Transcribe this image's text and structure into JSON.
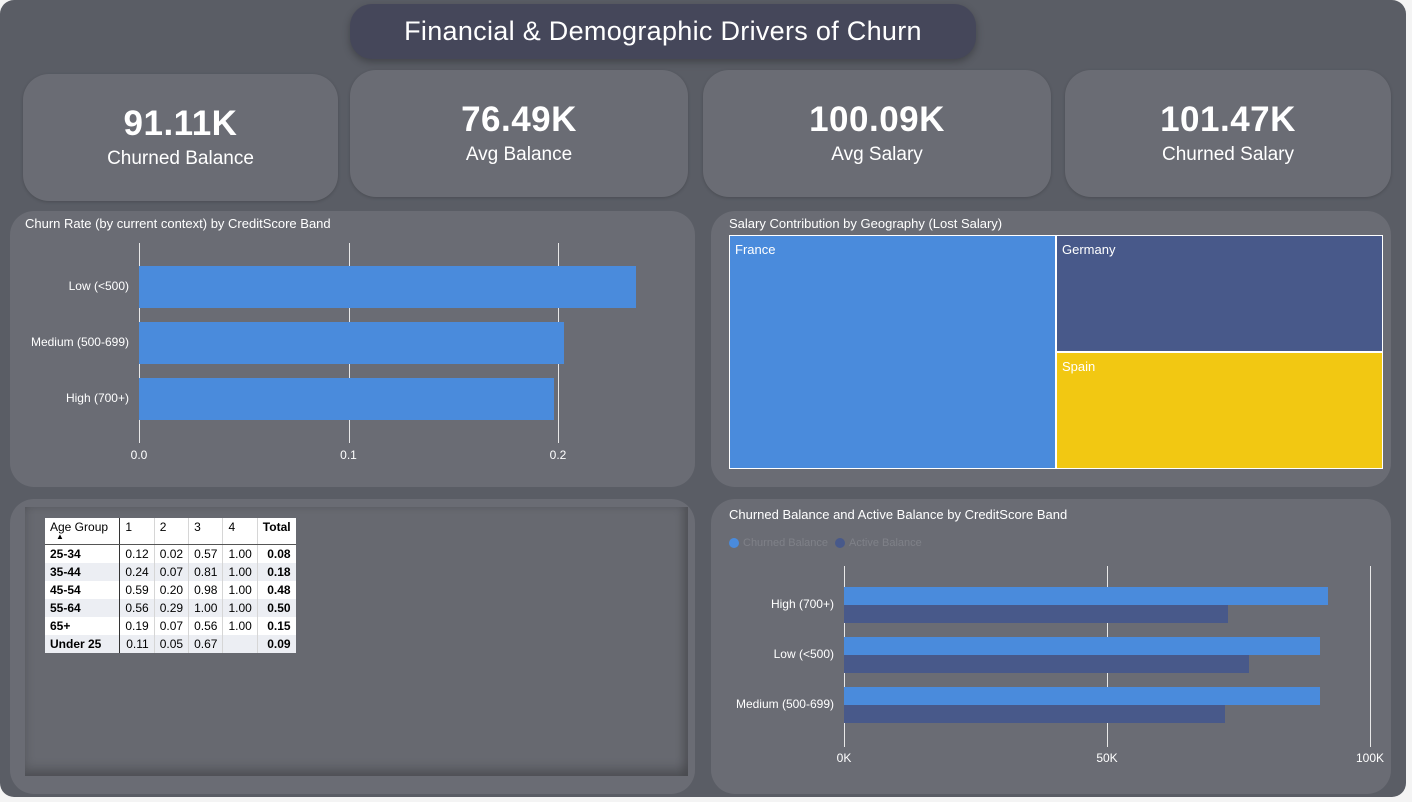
{
  "title": "Financial & Demographic Drivers of Churn",
  "kpis": [
    {
      "value": "91.11K",
      "label": "Churned Balance"
    },
    {
      "value": "76.49K",
      "label": "Avg Balance"
    },
    {
      "value": "100.09K",
      "label": "Avg Salary"
    },
    {
      "value": "101.47K",
      "label": "Churned Salary"
    }
  ],
  "colors": {
    "blue": "#4a8bdc",
    "navy": "#48598a",
    "yellow": "#f2c812",
    "panel": "#6a6c74",
    "canvas": "#5a5d65"
  },
  "chart_data": [
    {
      "type": "bar",
      "orientation": "horizontal",
      "title": "Churn Rate (by current context) by CreditScore Band",
      "categories": [
        "Low (<500)",
        "Medium (500-699)",
        "High (700+)"
      ],
      "values": [
        0.237,
        0.203,
        0.198
      ],
      "xlim": [
        0,
        0.2525
      ],
      "xticks": [
        "0.0",
        "0.1",
        "0.2"
      ],
      "grid": true
    },
    {
      "type": "treemap",
      "title": "Salary Contribution by Geography (Lost Salary)",
      "categories": [
        "France",
        "Germany",
        "Spain"
      ],
      "values": [
        50,
        25,
        25
      ],
      "colors": [
        "#4a8bdc",
        "#48598a",
        "#f2c812"
      ]
    },
    {
      "type": "bar",
      "orientation": "horizontal",
      "title": "Churned Balance and Active Balance by CreditScore Band",
      "categories": [
        "High (700+)",
        "Low (<500)",
        "Medium (500-699)"
      ],
      "series": [
        {
          "name": "Churned Balance",
          "values": [
            92000,
            90500,
            90500
          ],
          "color": "#4a8bdc"
        },
        {
          "name": "Active Balance",
          "values": [
            73000,
            77000,
            72500
          ],
          "color": "#48598a"
        }
      ],
      "xlim": [
        0,
        100000
      ],
      "xticks": [
        "0K",
        "50K",
        "100K"
      ],
      "grid": true,
      "legend": "top-left"
    },
    {
      "type": "table",
      "columns": [
        "Age Group",
        "1",
        "2",
        "3",
        "4",
        "Total"
      ],
      "rows": [
        [
          "25-34",
          "0.12",
          "0.02",
          "0.57",
          "1.00",
          "0.08"
        ],
        [
          "35-44",
          "0.24",
          "0.07",
          "0.81",
          "1.00",
          "0.18"
        ],
        [
          "45-54",
          "0.59",
          "0.20",
          "0.98",
          "1.00",
          "0.48"
        ],
        [
          "55-64",
          "0.56",
          "0.29",
          "1.00",
          "1.00",
          "0.50"
        ],
        [
          "65+",
          "0.19",
          "0.07",
          "0.56",
          "1.00",
          "0.15"
        ],
        [
          "Under 25",
          "0.11",
          "0.05",
          "0.67",
          "",
          "0.09"
        ]
      ]
    }
  ]
}
